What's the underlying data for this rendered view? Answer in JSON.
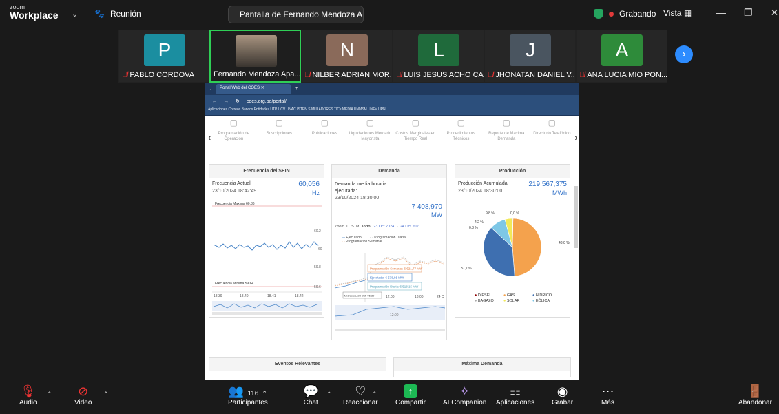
{
  "app": {
    "logo_top": "zoom",
    "logo_bottom": "Workplace",
    "meeting_label": "Reunión"
  },
  "share": {
    "label": "Pantalla de Fernando Mendoza A"
  },
  "recording": {
    "label": "Grabando"
  },
  "view": {
    "label": "Vista"
  },
  "participants": [
    {
      "initial": "P",
      "name": "PABLO CORDOVA",
      "color": "#1b8ea0",
      "muted": true
    },
    {
      "initial": "",
      "name": "Fernando Mendoza Apa...",
      "color": "#7a6a5a",
      "muted": false
    },
    {
      "initial": "N",
      "name": "NILBER ADRIAN MOR...",
      "color": "#8a6a5a",
      "muted": true
    },
    {
      "initial": "L",
      "name": "LUIS JESUS ACHO CA...",
      "color": "#1f6a3b",
      "muted": true
    },
    {
      "initial": "J",
      "name": "JHONATAN DANIEL V...",
      "color": "#4a5560",
      "muted": true
    },
    {
      "initial": "A",
      "name": "ANA LUCIA MIO PON...",
      "color": "#2e8b3a",
      "muted": true
    }
  ],
  "browser": {
    "tab_title": "Portal Web del COES",
    "url": "coes.org.pe/portal/",
    "bookmarks": "Aplicaciones  Correos  Bancos  Entidades  UTP  UCV  UNAC  ISTPN  SIMULADORES  TICs  MEDIA  UNMSM  UNFV  UPN"
  },
  "portal_icons": [
    "Programación de Operación",
    "Suscripciones",
    "Publicaciones",
    "Liquidaciones Mercado Mayorista",
    "Costos Marginales en Tiempo Real",
    "Procedimientos Técnicos",
    "Reporte de Máxima Demanda",
    "Directorio Telefónico"
  ],
  "frecuencia": {
    "title": "Frecuencia del SEIN",
    "label": "Frecuencia Actual:",
    "date": "23/10/2024 18:42:49",
    "value": "60,056",
    "unit": "Hz",
    "max_label": "Frecuencia Maxima 60.36",
    "min_label": "Frecuencia Minima 59.64",
    "y_ticks": [
      "60.2",
      "60",
      "59.8",
      "59.6"
    ],
    "x_ticks": [
      "18.39",
      "18.40",
      "18.41",
      "18.42"
    ]
  },
  "demanda": {
    "title": "Demanda",
    "label": "Demanda media horaria ejecutada:",
    "date": "23/10/2024 18:30:00",
    "value": "7 408,970",
    "unit": "MW",
    "zoom_label": "Zoom",
    "zoom_opts": [
      "D",
      "S",
      "M",
      "Todo"
    ],
    "date_from": "23 Oct 2024",
    "date_to": "24 Oct 202",
    "legend": [
      "Ejecutado",
      "Programación Diaria",
      "Programación Semanal"
    ],
    "tooltip_semanal": "Programación Semanal: 6 621,77 MW",
    "tooltip_ejecutado": "Ejecutado: 6 538,91 MW",
    "tooltip_diaria": "Programación Diaria: 6 518,15 MW",
    "tooltip_date": "Miércoles, 23 Oct, 06:30",
    "x_ticks": [
      "12:00",
      "18:00",
      "24 C"
    ],
    "nav_tick": "12:00"
  },
  "produccion": {
    "title": "Producción",
    "label": "Producción Acumulada:",
    "date": "23/10/2024 18:30:00",
    "value": "219 567,375",
    "unit": "MWh",
    "legend": [
      "DIESEL",
      "GAS",
      "HÍDRICO",
      "BAGAZO",
      "SOLAR",
      "EÓLICA"
    ],
    "legend_colors": [
      "#8b0000",
      "#f4a24d",
      "#3e6fb0",
      "#a9a9a9",
      "#f1e95a",
      "#7ec7e6"
    ]
  },
  "chart_data": {
    "type": "pie",
    "title": "",
    "labels": [
      "GAS",
      "HÍDRICO",
      "EÓLICA",
      "SOLAR",
      "BAGAZO"
    ],
    "values": [
      48.0,
      37.7,
      8.8,
      4.2,
      0.3
    ],
    "value_labels": [
      "48,0 %",
      "37,7 %",
      "9,8 %",
      "4,2 %",
      "0,3 %",
      "0,0 %"
    ],
    "colors": [
      "#f4a24d",
      "#3e6fb0",
      "#7ec7e6",
      "#f1e95a",
      "#a9a9a9"
    ]
  },
  "lower_panels": {
    "eventos": "Eventos Relevantes",
    "maxima": "Máxima Demanda"
  },
  "toolbar": {
    "audio": "Audio",
    "video": "Video",
    "participants": "Participantes",
    "participants_count": "116",
    "chat": "Chat",
    "react": "Reaccionar",
    "share": "Compartir",
    "ai": "AI Companion",
    "apps": "Aplicaciones",
    "record": "Grabar",
    "more": "Más",
    "leave": "Abandonar"
  }
}
